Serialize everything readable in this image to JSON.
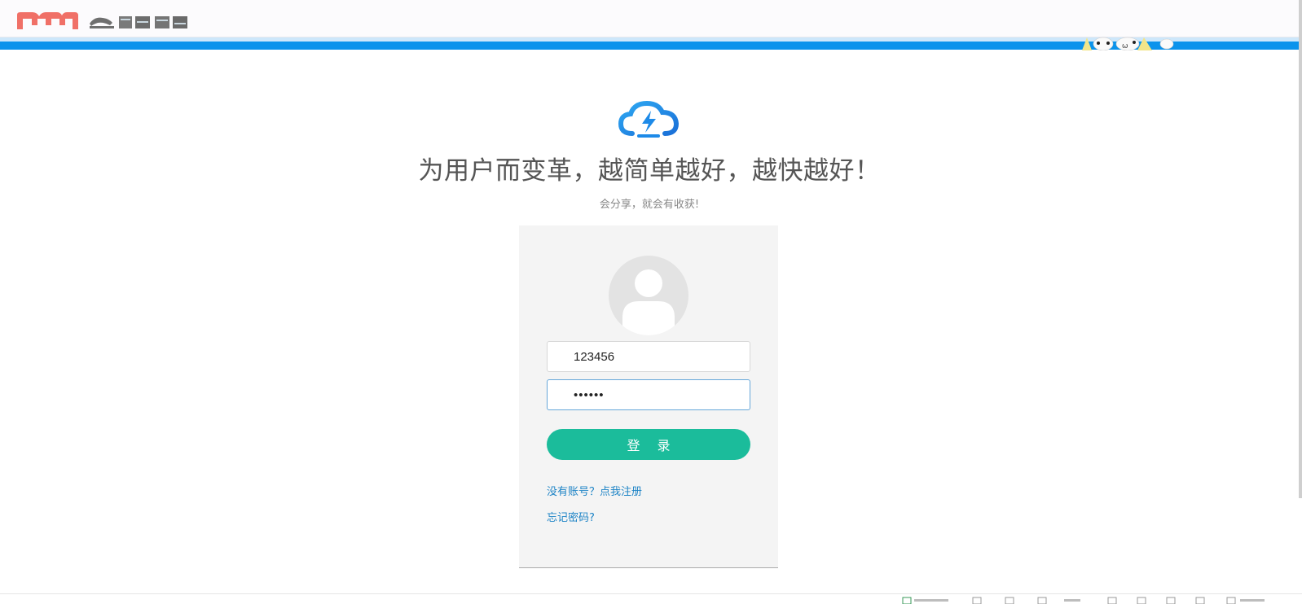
{
  "header": {
    "brand_logo_icon": "m-logo-icon",
    "brand_text_icon": "brand-wordmark-icon",
    "mascot_icon": "mascot-faces-icon",
    "colors": {
      "accent_blue": "#0a93ec",
      "logo_red": "#f07067"
    }
  },
  "hero": {
    "icon": "lightning-cloud-icon",
    "headline": "为用户而变革，越简单越好，越快越好！",
    "subline": "会分享，就会有收获!"
  },
  "login": {
    "avatar_icon": "user-avatar-icon",
    "username_value": "123456",
    "password_value": "••••••",
    "submit_label": "登 录",
    "register_link": "没有账号？点我注册",
    "forgot_link": "忘记密码?",
    "colors": {
      "button_green": "#1bbc9b",
      "link_blue": "#1e84c6"
    }
  }
}
